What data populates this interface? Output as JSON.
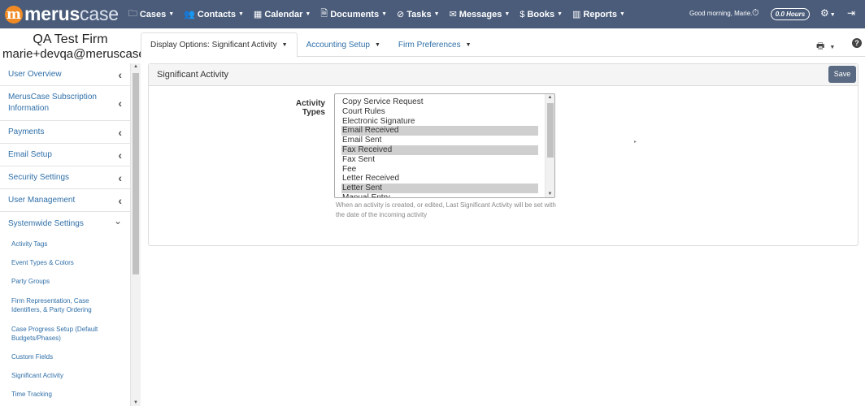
{
  "brand": {
    "logo_mark": "m",
    "name_bold": "merus",
    "name_light": "case"
  },
  "nav": [
    {
      "label": "Cases",
      "icon": "folder-icon",
      "glyph": "🗀"
    },
    {
      "label": "Contacts",
      "icon": "users-icon",
      "glyph": "👥"
    },
    {
      "label": "Calendar",
      "icon": "calendar-icon",
      "glyph": "▦"
    },
    {
      "label": "Documents",
      "icon": "document-icon",
      "glyph": "🗎"
    },
    {
      "label": "Tasks",
      "icon": "check-circle-icon",
      "glyph": "⊘"
    },
    {
      "label": "Messages",
      "icon": "envelope-icon",
      "glyph": "✉"
    },
    {
      "label": "Books",
      "icon": "dollar-icon",
      "glyph": "$"
    },
    {
      "label": "Reports",
      "icon": "chart-icon",
      "glyph": "▥"
    }
  ],
  "header": {
    "greeting": "Good morning, Marie.",
    "hours": "0.0 Hours"
  },
  "firm": {
    "name": "QA Test Firm",
    "email": "marie+devqa@meruscase"
  },
  "sidebar": {
    "items": [
      {
        "label": "User Overview",
        "name": "user-overview"
      },
      {
        "label": "MerusCase Subscription Information",
        "name": "subscription-information"
      },
      {
        "label": "Payments",
        "name": "payments"
      },
      {
        "label": "Email Setup",
        "name": "email-setup"
      },
      {
        "label": "Security Settings",
        "name": "security-settings"
      },
      {
        "label": "User Management",
        "name": "user-management"
      },
      {
        "label": "Systemwide Settings",
        "name": "systemwide-settings"
      }
    ],
    "sub_items": [
      {
        "label": "Activity Tags",
        "name": "activity-tags"
      },
      {
        "label": "Event Types & Colors",
        "name": "event-types-colors"
      },
      {
        "label": "Party Groups",
        "name": "party-groups"
      },
      {
        "label": "Firm Representation, Case Identifiers, & Party Ordering",
        "name": "firm-representation"
      },
      {
        "label": "Case Progress Setup (Default Budgets/Phases)",
        "name": "case-progress-setup"
      },
      {
        "label": "Custom Fields",
        "name": "custom-fields"
      },
      {
        "label": "Significant Activity",
        "name": "significant-activity"
      },
      {
        "label": "Time Tracking",
        "name": "time-tracking"
      }
    ]
  },
  "tabs": [
    {
      "label": "Display Options: Significant Activity",
      "name": "tab-display-options"
    },
    {
      "label": "Accounting Setup",
      "name": "tab-accounting-setup"
    },
    {
      "label": "Firm Preferences",
      "name": "tab-firm-preferences"
    }
  ],
  "panel": {
    "title": "Significant Activity",
    "save_label": "Save",
    "field_label": "Activity Types",
    "options": [
      {
        "label": "Copy Service Request",
        "selected": false
      },
      {
        "label": "Court Rules",
        "selected": false
      },
      {
        "label": "Electronic Signature",
        "selected": false
      },
      {
        "label": "Email Received",
        "selected": true
      },
      {
        "label": "Email Sent",
        "selected": false
      },
      {
        "label": "Fax Received",
        "selected": true
      },
      {
        "label": "Fax Sent",
        "selected": false
      },
      {
        "label": "Fee",
        "selected": false
      },
      {
        "label": "Letter Received",
        "selected": false
      },
      {
        "label": "Letter Sent",
        "selected": true
      },
      {
        "label": "Manual Entry",
        "selected": false
      }
    ],
    "help_text": "When an activity is created, or edited, Last Significant Activity will be set with the date of the incoming activity"
  }
}
